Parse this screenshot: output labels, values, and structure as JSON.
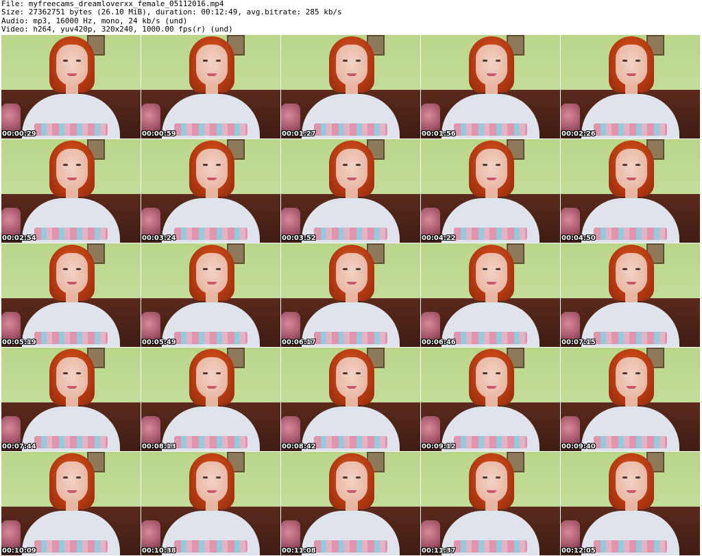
{
  "header": {
    "file": "File: myfreecams_dreamloverxx_female_05112016.mp4",
    "size": "Size: 27362751 bytes (26.10 MiB), duration: 00:12:49, avg.bitrate: 285 kb/s",
    "audio": "Audio: mp3, 16000 Hz, mono, 24 kb/s (und)",
    "video": "Video: h264, yuv420p, 320x240, 1000.00 fps(r) (und)"
  },
  "thumbnails": [
    {
      "timestamp": "00:00:29"
    },
    {
      "timestamp": "00:00:59"
    },
    {
      "timestamp": "00:01:27"
    },
    {
      "timestamp": "00:01:56"
    },
    {
      "timestamp": "00:02:26"
    },
    {
      "timestamp": "00:02:54"
    },
    {
      "timestamp": "00:03:24"
    },
    {
      "timestamp": "00:03:52"
    },
    {
      "timestamp": "00:04:22"
    },
    {
      "timestamp": "00:04:50"
    },
    {
      "timestamp": "00:05:19"
    },
    {
      "timestamp": "00:05:49"
    },
    {
      "timestamp": "00:06:17"
    },
    {
      "timestamp": "00:06:46"
    },
    {
      "timestamp": "00:07:15"
    },
    {
      "timestamp": "00:07:44"
    },
    {
      "timestamp": "00:08:13"
    },
    {
      "timestamp": "00:08:42"
    },
    {
      "timestamp": "00:09:12"
    },
    {
      "timestamp": "00:09:40"
    },
    {
      "timestamp": "00:10:09"
    },
    {
      "timestamp": "00:10:38"
    },
    {
      "timestamp": "00:11:08"
    },
    {
      "timestamp": "00:11:37"
    },
    {
      "timestamp": "00:12:05"
    }
  ]
}
